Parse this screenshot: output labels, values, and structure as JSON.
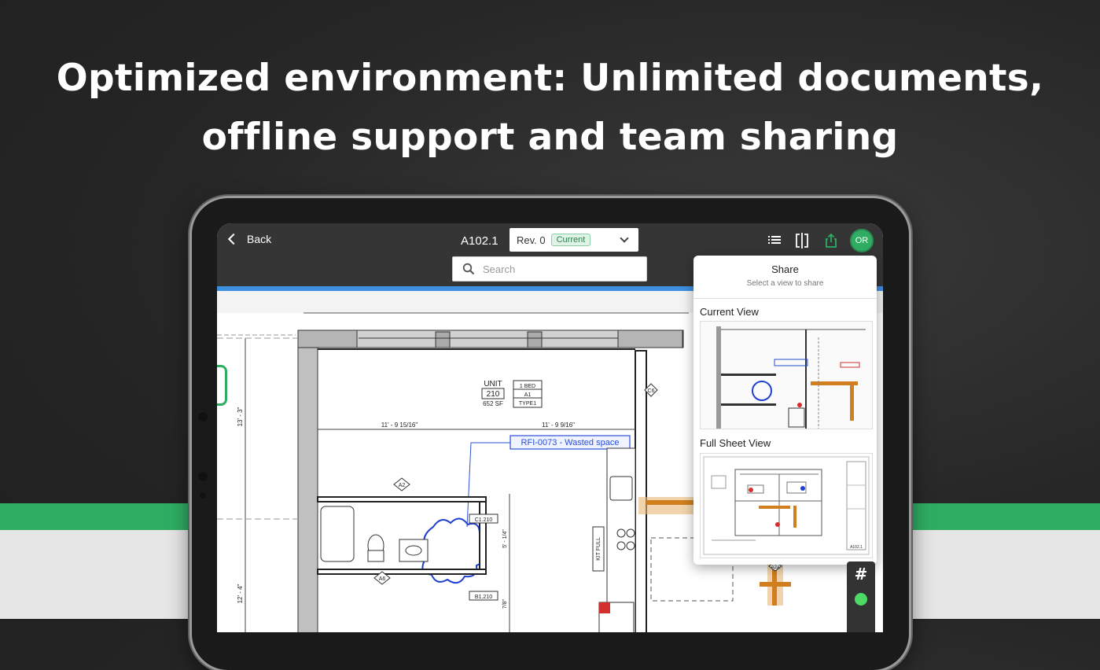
{
  "headline": {
    "line1": "Optimized environment: Unlimited documents,",
    "line2": "offline support and team sharing"
  },
  "app": {
    "back_label": "Back",
    "sheet_number": "A102.1",
    "revision": {
      "label": "Rev. 0",
      "status": "Current"
    },
    "search": {
      "placeholder": "Search"
    },
    "user_initials": "OR",
    "accent_color": "#2fae63",
    "toolbar_icons": [
      "list-icon",
      "compare-icon",
      "share-icon"
    ]
  },
  "drawing": {
    "unit_label": "UNIT",
    "unit_number": "210",
    "unit_area": "652 SF",
    "unit_tags": [
      "1 BED",
      "A1",
      "TYPE1"
    ],
    "dim_left": "11' - 9 15/16\"",
    "dim_right": "11' - 9 9/16\"",
    "dim_vert_upper": "13' - 3\"",
    "dim_vert_lower": "12' - 4\"",
    "dim_small_1": "5' - 1/4\"",
    "dim_small_2": "7/8\"",
    "rfi_label": "RFI-0073 - Wasted space",
    "tags": {
      "c6": "C6",
      "a2": "A2",
      "a6": "A6",
      "a2b": "A2a"
    },
    "room_tags": [
      "C1.210",
      "B1.210"
    ],
    "kit_full": "KIT FULL",
    "edge_text": "66"
  },
  "share_panel": {
    "title": "Share",
    "subtitle": "Select a view to share",
    "current_view_label": "Current View",
    "full_sheet_label": "Full Sheet View",
    "full_sheet_corner": "A102.1"
  },
  "tools": {
    "hash": "#"
  }
}
